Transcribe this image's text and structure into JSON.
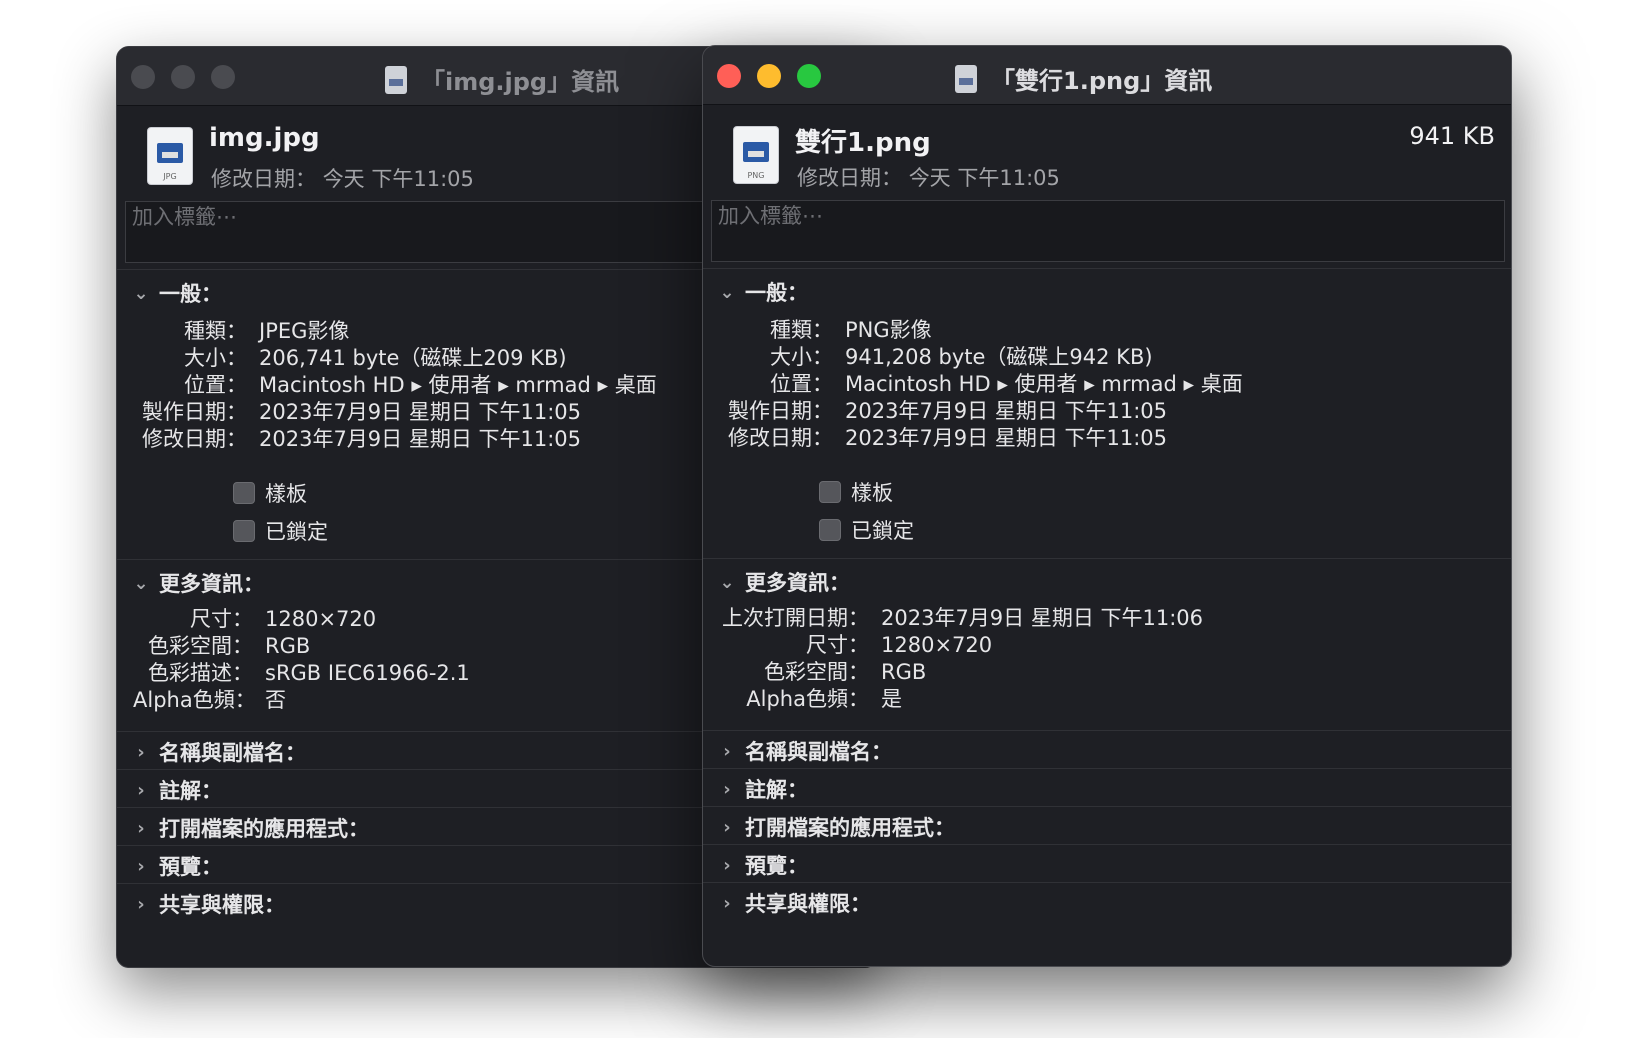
{
  "back": {
    "title": "「img.jpg」資訊",
    "file_name": "img.jpg",
    "file_ext": "JPG",
    "modified_label": "修改日期：",
    "modified_value": "今天 下午11:05",
    "tags_placeholder": "加入標籤⋯",
    "general": {
      "title": "一般：",
      "rows": [
        {
          "k": "種類：",
          "v": "JPEG影像"
        },
        {
          "k": "大小：",
          "v": "206,741 byte（磁碟上209 KB)"
        },
        {
          "k": "位置：",
          "v": "Macintosh HD ▸ 使用者 ▸ mrmad ▸ 桌面"
        },
        {
          "k": "製作日期：",
          "v": "2023年7月9日 星期日 下午11:05"
        },
        {
          "k": "修改日期：",
          "v": "2023年7月9日 星期日 下午11:05"
        }
      ],
      "stationery": "樣板",
      "locked": "已鎖定"
    },
    "more": {
      "title": "更多資訊：",
      "rows": [
        {
          "k": "尺寸：",
          "v": "1280×720"
        },
        {
          "k": "色彩空間：",
          "v": "RGB"
        },
        {
          "k": "色彩描述：",
          "v": "sRGB IEC61966-2.1"
        },
        {
          "k": "Alpha色頻：",
          "v": "否"
        }
      ]
    },
    "collapsed": [
      "名稱與副檔名：",
      "註解：",
      "打開檔案的應用程式：",
      "預覽：",
      "共享與權限："
    ]
  },
  "front": {
    "title": "「雙行1.png」資訊",
    "file_name": "雙行1.png",
    "file_ext": "PNG",
    "file_size": "941 KB",
    "modified_label": "修改日期：",
    "modified_value": "今天 下午11:05",
    "tags_placeholder": "加入標籤⋯",
    "general": {
      "title": "一般：",
      "rows": [
        {
          "k": "種類：",
          "v": "PNG影像"
        },
        {
          "k": "大小：",
          "v": "941,208 byte（磁碟上942 KB)"
        },
        {
          "k": "位置：",
          "v": "Macintosh HD ▸ 使用者 ▸ mrmad ▸ 桌面"
        },
        {
          "k": "製作日期：",
          "v": "2023年7月9日 星期日 下午11:05"
        },
        {
          "k": "修改日期：",
          "v": "2023年7月9日 星期日 下午11:05"
        }
      ],
      "stationery": "樣板",
      "locked": "已鎖定"
    },
    "more": {
      "title": "更多資訊：",
      "rows": [
        {
          "k": "上次打開日期：",
          "v": "2023年7月9日 星期日 下午11:06"
        },
        {
          "k": "尺寸：",
          "v": "1280×720"
        },
        {
          "k": "色彩空間：",
          "v": "RGB"
        },
        {
          "k": "Alpha色頻：",
          "v": "是"
        }
      ]
    },
    "collapsed": [
      "名稱與副檔名：",
      "註解：",
      "打開檔案的應用程式：",
      "預覽：",
      "共享與權限："
    ]
  }
}
